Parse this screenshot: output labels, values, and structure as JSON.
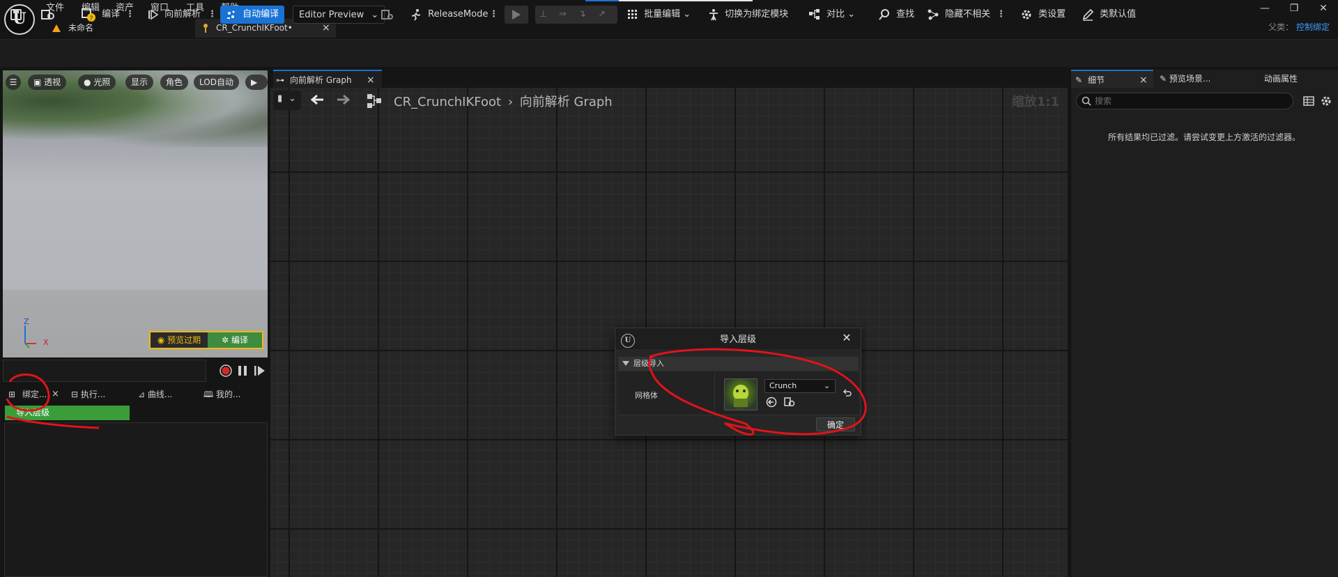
{
  "menu": {
    "file": "文件",
    "edit": "编辑",
    "asset": "资产",
    "window": "窗口",
    "tools": "工具",
    "help": "帮助"
  },
  "tabs": {
    "untitled": "未命名",
    "document": "CR_CrunchIKFoot•",
    "close": "×"
  },
  "window": {
    "minimize": "—",
    "restore": "❐",
    "close": "✕"
  },
  "parent": {
    "key": "父类：",
    "value": "控制绑定"
  },
  "toolbar": {
    "compile": "编译",
    "forward_solve": "向前解析",
    "auto_compile": "自动编译",
    "editor_preview": "Editor Preview",
    "release_mode": "ReleaseMode",
    "bulk_edit": "批量编辑",
    "switch_module": "切换为绑定模块",
    "diff": "对比",
    "find": "查找",
    "hide_unrelated": "隐藏不相关",
    "class_settings": "类设置",
    "class_defaults": "类默认值"
  },
  "viewport": {
    "buttons": [
      "透视",
      "光照",
      "显示",
      "角色",
      "LOD自动"
    ],
    "preview_expired": "预览过期",
    "preview_edit": "编译",
    "axis_z": "Z",
    "axis_x": "X"
  },
  "left_tabs": {
    "rig": "绑定...",
    "exec": "执行...",
    "curve": "曲线...",
    "mine": "我的..."
  },
  "import_button": "导入层级",
  "graph": {
    "tab_label": "向前解析 Graph",
    "crumb_asset": "CR_CrunchIKFoot",
    "crumb_sep": "›",
    "crumb_graph": "向前解析 Graph",
    "zoom": "缩放1:1"
  },
  "dialog": {
    "title": "导入层级",
    "section": "层级导入",
    "label": "网格体",
    "mesh_value": "Crunch",
    "ok": "确定"
  },
  "details": {
    "tab_details": "细节",
    "tab_preview": "预览场景...",
    "tab_anim": "动画属性",
    "search_placeholder": "搜索",
    "empty_message": "所有结果均已过滤。请尝试变更上方激活的过滤器。"
  },
  "colors": {
    "accent": "#1a73d4",
    "annotation": "#e0141a",
    "import_green": "#3a9d3a",
    "warning": "#f2b90c"
  }
}
